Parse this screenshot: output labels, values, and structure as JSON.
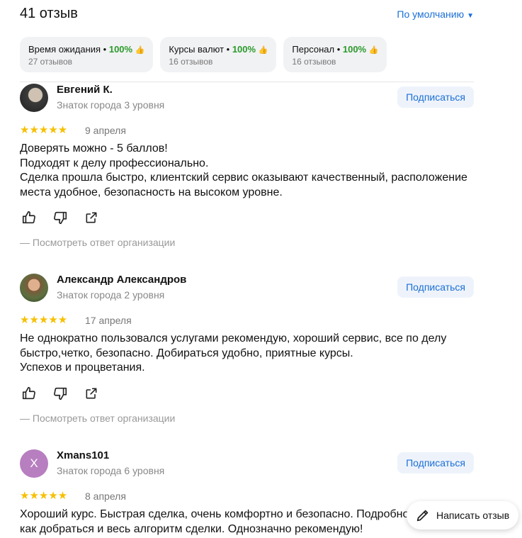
{
  "header": {
    "count": "41 отзыв",
    "sort_label": "По умолчанию"
  },
  "chips": [
    {
      "label": "Время ожидания",
      "percent": "100%",
      "reviews": "27 отзывов"
    },
    {
      "label": "Курсы валют",
      "percent": "100%",
      "reviews": "16 отзывов"
    },
    {
      "label": "Персонал",
      "percent": "100%",
      "reviews": "16 отзывов"
    }
  ],
  "reviews": [
    {
      "name": "Евгений К.",
      "level": "Знаток города 3 уровня",
      "subscribe": "Подписаться",
      "rating": 5,
      "date": "9 апреля",
      "text": [
        "Доверять можно - 5 баллов!",
        "Подходят к делу профессионально.",
        "Сделка прошла быстро, клиентский сервис оказывают качественный, расположение",
        "места удобное, безопасность на высоком уровне."
      ],
      "org_response": "— Посмотреть ответ организации"
    },
    {
      "name": "Александр Александров",
      "level": "Знаток города 2 уровня",
      "subscribe": "Подписаться",
      "rating": 5,
      "date": "17 апреля",
      "text": [
        "Не однократно пользовался услугами рекомендую, хороший сервис, все по делу",
        "быстро,четко, безопасно. Добираться удобно, приятные курсы.",
        "Успехов и процветания."
      ],
      "org_response": "— Посмотреть ответ организации"
    },
    {
      "name": "Xmans101",
      "avatar_letter": "X",
      "level": "Знаток города 6 уровня",
      "subscribe": "Подписаться",
      "rating": 5,
      "date": "8 апреля",
      "text": [
        "Хороший курс. Быстрая сделка, очень комфортно и безопасно. Подробно",
        "как добраться и весь алгоритм сделки. Однозначно рекомендую!"
      ]
    }
  ],
  "write_review": "Написать отзыв",
  "colors": {
    "accent": "#1a6fd6",
    "green": "#2a9a2a",
    "star": "#f6c000",
    "avatar_x": "#b77ec0"
  }
}
